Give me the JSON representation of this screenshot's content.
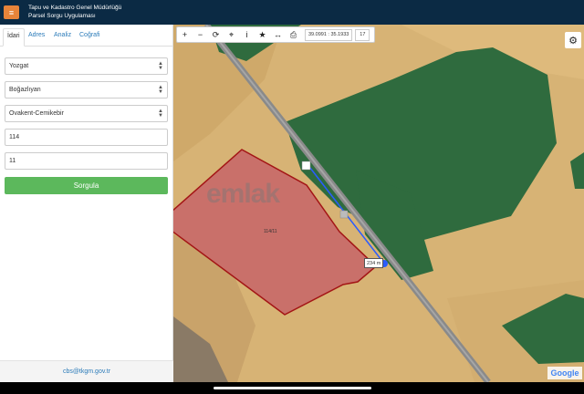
{
  "header": {
    "title_line1": "Tapu ve Kadastro Genel Müdürlüğü",
    "title_line2": "Parsel Sorgu Uygulaması",
    "menu_icon": "hamburger-icon"
  },
  "tabs": [
    {
      "label": "İdari",
      "active": true
    },
    {
      "label": "Adres",
      "active": false
    },
    {
      "label": "Analiz",
      "active": false
    },
    {
      "label": "Coğrafi",
      "active": false
    }
  ],
  "form": {
    "province": "Yozgat",
    "district": "Boğazlıyan",
    "neighborhood": "Ovakent-Cemikebir",
    "block": "114",
    "parcel": "11",
    "query_label": "Sorgula"
  },
  "footer": {
    "email": "cbs@tkgm.gov.tr"
  },
  "map": {
    "coordinates": "39.0991 : 35.1933",
    "zoom_level": "17",
    "distance_label": "234 m",
    "parcel_label": "114/11",
    "watermark": "emlak",
    "attribution": "Google",
    "colors": {
      "field": "#d9b577",
      "crop": "#2f6b3e",
      "parcel": "#c9706a",
      "road": "#8a8a8a",
      "measure": "#2a5cff"
    }
  },
  "toolbar_icons": [
    "zoom-in-icon",
    "zoom-out-icon",
    "refresh-icon",
    "locate-icon",
    "info-icon",
    "bookmark-icon",
    "measure-icon",
    "print-icon"
  ]
}
